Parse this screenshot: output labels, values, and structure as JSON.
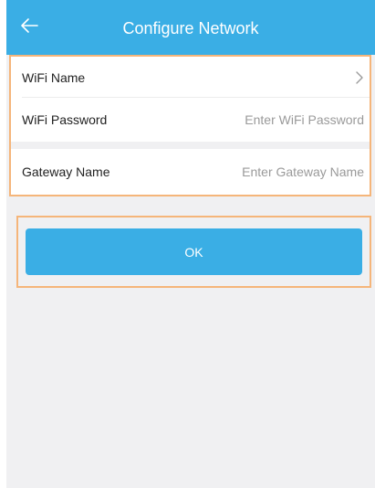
{
  "header": {
    "title": "Configure Network",
    "back_icon": "arrow-left-icon"
  },
  "form": {
    "wifi_name": {
      "label": "WiFi Name",
      "value": "",
      "icon": "chevron-right-icon"
    },
    "wifi_password": {
      "label": "WiFi Password",
      "placeholder": "Enter WiFi Password"
    },
    "gateway_name": {
      "label": "Gateway Name",
      "placeholder": "Enter Gateway Name"
    }
  },
  "actions": {
    "ok_label": "OK"
  },
  "colors": {
    "primary": "#3aaee5",
    "background": "#f0f0f2",
    "highlight": "#f5b57a"
  }
}
